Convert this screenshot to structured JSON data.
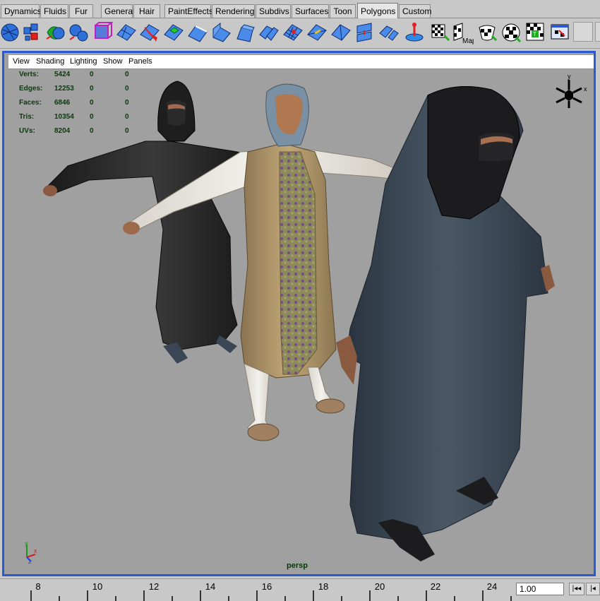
{
  "shelf_tabs": [
    {
      "label": "Dynamics",
      "active": false
    },
    {
      "label": "Fluids",
      "active": false
    },
    {
      "label": "Fur",
      "active": false
    },
    {
      "label": "General",
      "active": false
    },
    {
      "label": "Hair",
      "active": false
    },
    {
      "label": "PaintEffects",
      "active": false
    },
    {
      "label": "Rendering",
      "active": false
    },
    {
      "label": "Subdivs",
      "active": false
    },
    {
      "label": "Surfaces",
      "active": false
    },
    {
      "label": "Toon",
      "active": false
    },
    {
      "label": "Polygons",
      "active": true
    },
    {
      "label": "Custom",
      "active": false
    }
  ],
  "shelf_icons": [
    "sphere-icon",
    "cube-icon",
    "combine-icon",
    "separate-icon",
    "bounding-box-icon",
    "plane-icon",
    "split-icon",
    "extrude-face-icon",
    "extrude-edge-icon",
    "wedge-icon",
    "bevel-icon",
    "merge-icon",
    "subdivide-icon",
    "triangulate-icon",
    "quadrangulate-icon",
    "append-icon",
    "split-polygon-icon",
    "smooth-icon",
    "mirror-icon",
    "uv-planar-icon",
    "uv-map-icon",
    "uv-cylindrical-icon",
    "uv-automatic-icon",
    "uv-editor-icon",
    "uv-texture-icon"
  ],
  "shelf_icon_text": {
    "uv_map": "Map"
  },
  "panel_menu": [
    "View",
    "Shading",
    "Lighting",
    "Show",
    "Panels"
  ],
  "hud_stats": [
    {
      "label": "Verts:",
      "values": [
        "5424",
        "0",
        "0"
      ]
    },
    {
      "label": "Edges:",
      "values": [
        "12253",
        "0",
        "0"
      ]
    },
    {
      "label": "Faces:",
      "values": [
        "6846",
        "0",
        "0"
      ]
    },
    {
      "label": "Tris:",
      "values": [
        "10354",
        "0",
        "0"
      ]
    },
    {
      "label": "UVs:",
      "values": [
        "8204",
        "0",
        "0"
      ]
    }
  ],
  "camera_label": "persp",
  "view_cube_axes": {
    "y": "y",
    "x": "x"
  },
  "origin_axes": {
    "y": "y",
    "x": "x",
    "z": "z"
  },
  "timeline_ticks": [
    "8",
    "10",
    "12",
    "14",
    "16",
    "18",
    "20",
    "22",
    "24"
  ],
  "current_frame": "1.00",
  "playback_buttons": [
    "|◂◂",
    "|◂"
  ],
  "colors": {
    "viewport_border": "#2a5ad0",
    "viewport_bg": "#a0a0a0",
    "hud_text": "#0a3a0a"
  }
}
